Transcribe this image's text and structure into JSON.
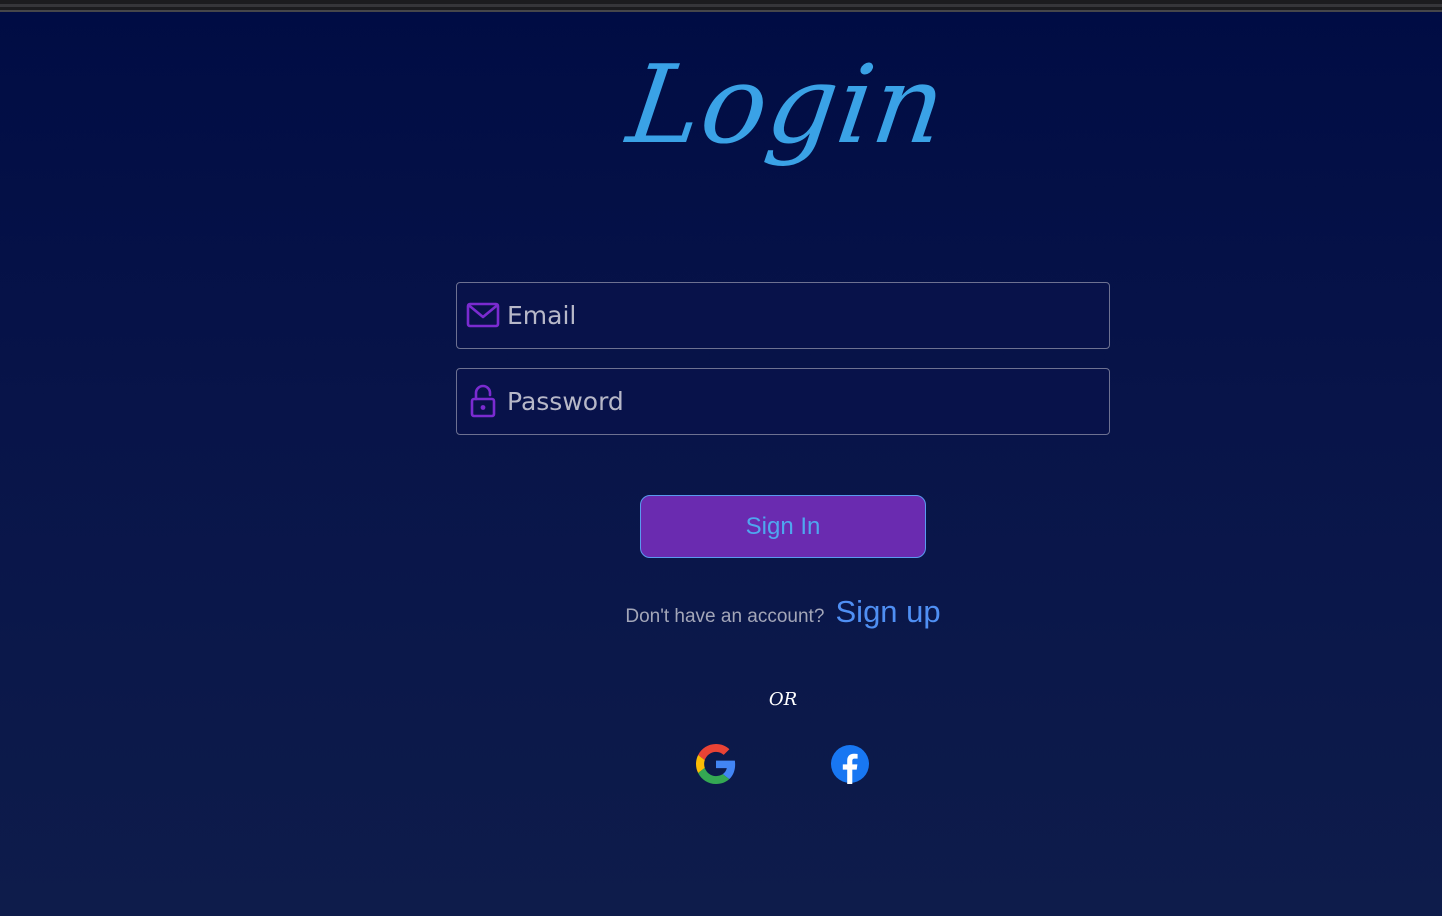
{
  "title": "Login",
  "email": {
    "placeholder": "Email",
    "icon": "envelope-icon"
  },
  "password": {
    "placeholder": "Password",
    "icon": "lock-icon"
  },
  "signin": {
    "label": "Sign In"
  },
  "signup": {
    "prompt": "Don't have an account?",
    "link_label": "Sign up"
  },
  "divider_text": "OR",
  "social": {
    "google_icon": "google-icon",
    "facebook_icon": "facebook-icon"
  },
  "colors": {
    "title": "#3aa2e6",
    "button_bg": "#6a2bb0",
    "button_text": "#4fa7ef",
    "link": "#4f8ff3",
    "icon": "#7a2bd0"
  }
}
